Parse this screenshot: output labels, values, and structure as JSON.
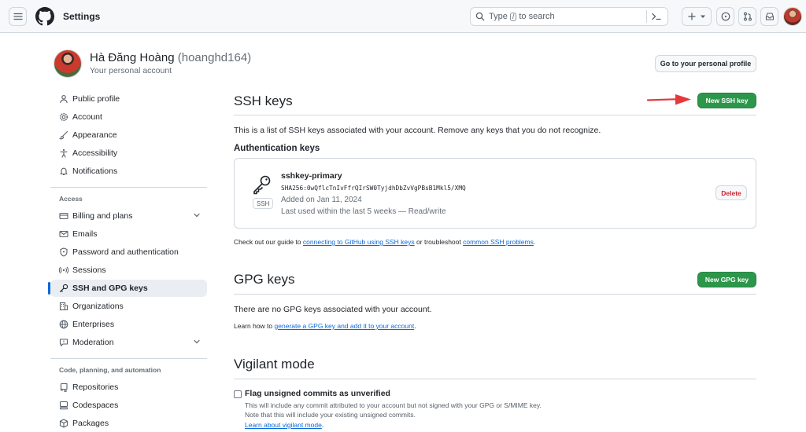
{
  "header": {
    "page_title": "Settings",
    "search_text": "Type / to search",
    "search_prefix": "Type",
    "search_key": "/",
    "search_suffix": "to search"
  },
  "user": {
    "display_name": "Hà Đăng Hoàng",
    "login": "(hoanghd164)",
    "subtitle": "Your personal account",
    "profile_button": "Go to your personal profile"
  },
  "sidebar": {
    "items_top": [
      {
        "label": "Public profile",
        "icon": "person-icon"
      },
      {
        "label": "Account",
        "icon": "gear-icon"
      },
      {
        "label": "Appearance",
        "icon": "paintbrush-icon"
      },
      {
        "label": "Accessibility",
        "icon": "accessibility-icon"
      },
      {
        "label": "Notifications",
        "icon": "bell-icon"
      }
    ],
    "group_access": "Access",
    "items_access": [
      {
        "label": "Billing and plans",
        "icon": "credit-card-icon"
      },
      {
        "label": "Emails",
        "icon": "mail-icon"
      },
      {
        "label": "Password and authentication",
        "icon": "shield-lock-icon"
      },
      {
        "label": "Sessions",
        "icon": "broadcast-icon"
      },
      {
        "label": "SSH and GPG keys",
        "icon": "key-icon"
      },
      {
        "label": "Organizations",
        "icon": "organization-icon"
      },
      {
        "label": "Enterprises",
        "icon": "globe-icon"
      },
      {
        "label": "Moderation",
        "icon": "report-icon"
      }
    ],
    "group_code": "Code, planning, and automation",
    "items_code": [
      {
        "label": "Repositories",
        "icon": "repo-icon"
      },
      {
        "label": "Codespaces",
        "icon": "codespaces-icon"
      },
      {
        "label": "Packages",
        "icon": "package-icon"
      }
    ]
  },
  "ssh": {
    "title": "SSH keys",
    "new_button": "New SSH key",
    "description": "This is a list of SSH keys associated with your account. Remove any keys that you do not recognize.",
    "auth_heading": "Authentication keys",
    "key": {
      "badge": "SSH",
      "name": "sshkey-primary",
      "fingerprint": "SHA256:0wQflcTnIvFfrQIrSW0TyjdhDbZvVgPBsB1Mkl5/XMQ",
      "added": "Added on Jan 11, 2024",
      "last_used": "Last used within the last 5 weeks — Read/write",
      "delete_button": "Delete"
    },
    "guide_prefix": "Check out our guide to",
    "guide_link1": "connecting to GitHub using SSH keys",
    "guide_middle": "or troubleshoot",
    "guide_link2": "common SSH problems",
    "guide_end": "."
  },
  "gpg": {
    "title": "GPG keys",
    "new_button": "New GPG key",
    "empty_text": "There are no GPG keys associated with your account.",
    "learn_prefix": "Learn how to",
    "learn_link": "generate a GPG key and add it to your account",
    "learn_end": "."
  },
  "vigilant": {
    "title": "Vigilant mode",
    "checkbox_label": "Flag unsigned commits as unverified",
    "line1": "This will include any commit attributed to your account but not signed with your GPG or S/MIME key.",
    "line2": "Note that this will include your existing unsigned commits.",
    "learn_link": "Learn about vigilant mode",
    "learn_end": "."
  },
  "colors": {
    "primary_button": "#2c974b",
    "link": "#0969da",
    "danger": "#cf222e",
    "annotation_arrow": "#e5383b"
  }
}
